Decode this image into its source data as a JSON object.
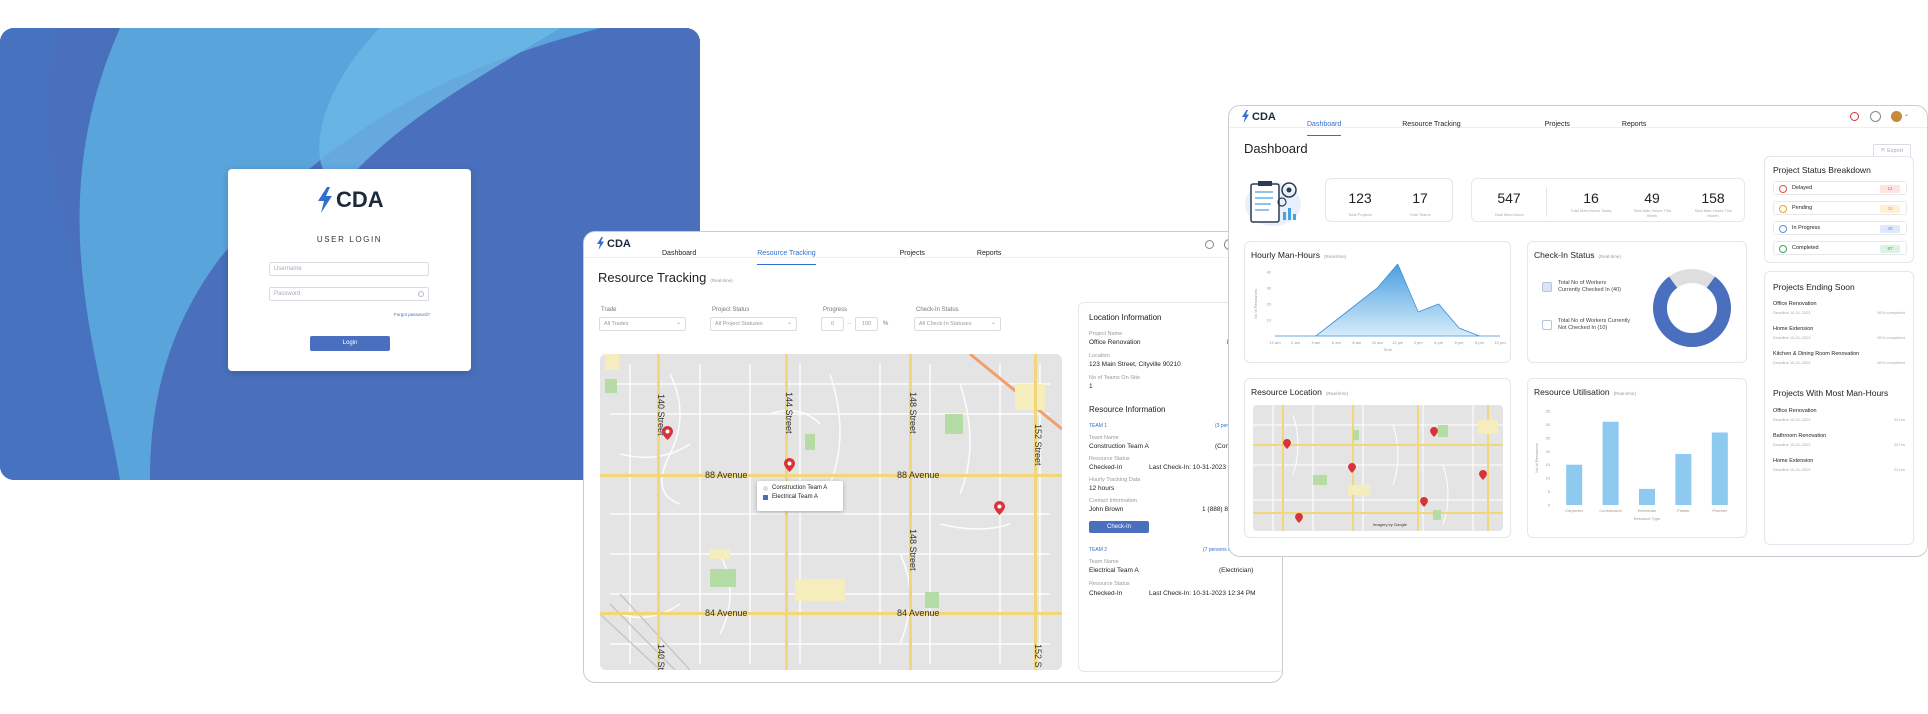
{
  "login": {
    "logo_text": "CDA",
    "title": "USER LOGIN",
    "username_placeholder": "Username",
    "password_placeholder": "Password",
    "forgot": "Forgot password?",
    "button": "Login"
  },
  "rt": {
    "logo_text": "CDA",
    "nav": [
      "Dashboard",
      "Resource Tracking",
      "Projects",
      "Reports"
    ],
    "title": "Resource Tracking",
    "title_note": "(Real-time)",
    "filters": {
      "trade_label": "Trade",
      "trade_value": "All Trades",
      "status_label": "Project Status",
      "status_value": "All Project Statuses",
      "progress_label": "Progress",
      "progress_min": "0",
      "progress_max": "100",
      "progress_unit": "%",
      "checkin_label": "Check-In Status",
      "checkin_value": "All Check-In Statuses"
    },
    "map": {
      "streets_h": [
        "88 Avenue",
        "88 Avenue",
        "84 Avenue",
        "84 Avenue"
      ],
      "streets_v": [
        "140 Street",
        "144 Street",
        "148 Street",
        "148 Street",
        "152 Street",
        "140 St",
        "152 S"
      ],
      "legend": [
        "Construction Team A",
        "Electrical Team A"
      ]
    },
    "info": {
      "loc_head": "Location Information",
      "project_name_lbl": "Project Name",
      "project_name": "Office Renovation",
      "project_status_initial": "P",
      "location_lbl": "Location",
      "location": "123 Main Street, Cityville 90210",
      "teams_lbl": "No of Teams On-Site",
      "teams": "1",
      "res_head": "Resource Information",
      "team1": "TEAM 1",
      "team1_persons": "(3 persons",
      "team_name_lbl": "Team Name",
      "team1_name": "Construction Team A",
      "team1_trade": "(Con",
      "res_status_lbl": "Resource Status",
      "team1_status": "Checked-In",
      "team1_last": "Last Check-In: 10-31-2023",
      "hours_lbl": "Hourly Tracking Data",
      "hours": "12 hours",
      "contact_lbl": "Contact Information",
      "contact_name": "John Brown",
      "contact_phone": "1 (888) 888-",
      "checkin_btn": "Check-In",
      "team2": "TEAM 2",
      "team2_persons": "(7 persons on-site)",
      "team2_name_lbl": "Team Name",
      "team2_name": "Electrical Team A",
      "team2_trade": "(Electrician)",
      "team2_status_lbl": "Resource Status",
      "team2_status": "Checked-In",
      "team2_last": "Last Check-In: 10-31-2023 12:34 PM"
    }
  },
  "db": {
    "logo_text": "CDA",
    "nav": [
      "Dashboard",
      "Resource Tracking",
      "Projects",
      "Reports"
    ],
    "title": "Dashboard",
    "export": "Export",
    "stats": [
      {
        "value": "123",
        "label": "Total Projects"
      },
      {
        "value": "17",
        "label": "Total Teams"
      },
      {
        "value": "547",
        "label": "Total Man-Hours"
      },
      {
        "value": "16",
        "label": "Total Man-Hours Today"
      },
      {
        "value": "49",
        "label": "Total Man-Hours This Week"
      },
      {
        "value": "158",
        "label": "Total Man-Hours This Month"
      }
    ],
    "hourly_title": "Hourly Man-Hours",
    "hourly_note": "(Real-time)",
    "hourly_ylabel": "No of Resources",
    "hourly_xlabel": "Time",
    "checkin_title": "Check-In Status",
    "checkin_note": "(Real-time)",
    "checkin_in": "Total No of Workers Currently Checked In (40)",
    "checkin_out": "Total No of Workers Currently Not Checked In (10)",
    "resloc_title": "Resource Location",
    "resloc_note": "(Real-time)",
    "resloc_attrib": "Imagery by Google",
    "util_title": "Resource Utilisation",
    "util_note": "(Real-time)",
    "util_ylabel": "No of Resources",
    "util_xlabel": "Resource Type",
    "psb_title": "Project Status Breakdown",
    "psb": [
      {
        "label": "Delayed",
        "value": "11",
        "color": "#e5534b",
        "bg": "#fde3e1"
      },
      {
        "label": "Pending",
        "value": "33",
        "color": "#e3a32a",
        "bg": "#fdf0d6"
      },
      {
        "label": "In Progress",
        "value": "40",
        "color": "#5b8fd9",
        "bg": "#dde9fa"
      },
      {
        "label": "Completed",
        "value": "87",
        "color": "#3ea85b",
        "bg": "#ddf2e2"
      }
    ],
    "ending_title": "Projects Ending Soon",
    "ending": [
      {
        "name": "Office Renovation",
        "date": "Deadline 10-31-2023",
        "right": "80% completed"
      },
      {
        "name": "Home Extension",
        "date": "Deadline 10-31-2023",
        "right": "80% completed"
      },
      {
        "name": "Kitchen & Dining Room Renovation",
        "date": "Deadline 10-31-2023",
        "right": "80% completed"
      }
    ],
    "most_title": "Projects With Most Man-Hours",
    "most": [
      {
        "name": "Office Renovation",
        "date": "Deadline 10-31-2023",
        "right": "24 hrs"
      },
      {
        "name": "Bathroom Renovation",
        "date": "Deadline 10-31-2023",
        "right": "24 hrs"
      },
      {
        "name": "Home Extension",
        "date": "Deadline 10-31-2023",
        "right": "24 hrs"
      }
    ]
  },
  "chart_data": [
    {
      "type": "area",
      "title": "Hourly Man-Hours",
      "xlabel": "Time",
      "ylabel": "No of Resources",
      "x": [
        "12 am",
        "2 am",
        "4 am",
        "6 am",
        "8 am",
        "10 am",
        "12 pm",
        "2 pm",
        "4 pm",
        "6 pm",
        "8 pm",
        "10 pm"
      ],
      "values": [
        0,
        0,
        0,
        10,
        20,
        30,
        45,
        15,
        20,
        5,
        0,
        0
      ],
      "ylim": [
        0,
        40
      ],
      "yticks": [
        10,
        20,
        30,
        40
      ],
      "color": "#4a9fe0"
    },
    {
      "type": "bar",
      "title": "Resource Utilisation",
      "xlabel": "Resource Type",
      "ylabel": "No of Resources",
      "categories": [
        "Carpenter",
        "Construction",
        "Electrician",
        "Painter",
        "Plumber"
      ],
      "values": [
        15,
        31,
        6,
        19,
        27
      ],
      "ylim": [
        0,
        35
      ],
      "yticks": [
        0,
        5,
        10,
        15,
        20,
        25,
        30,
        35
      ],
      "color": "#8ec9ef"
    },
    {
      "type": "pie",
      "title": "Check-In Status",
      "categories": [
        "Checked In",
        "Not Checked In"
      ],
      "values": [
        40,
        10
      ],
      "colors": [
        "#4a6fbf",
        "#dedede"
      ]
    }
  ]
}
